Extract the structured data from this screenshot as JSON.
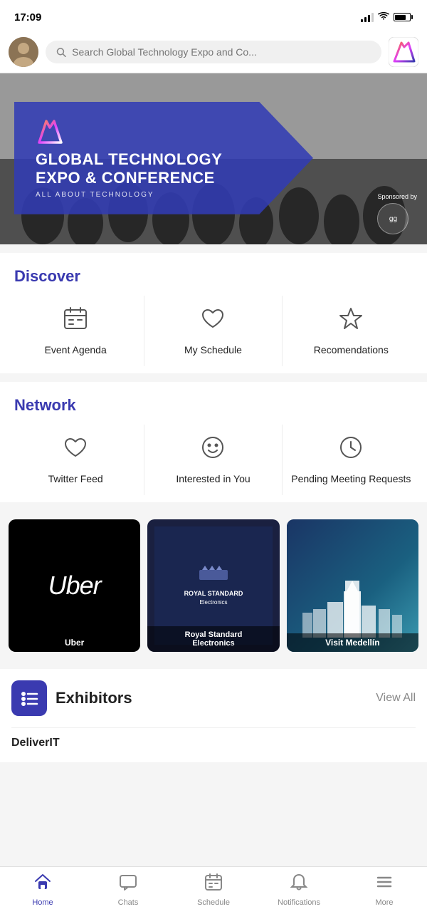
{
  "statusBar": {
    "time": "17:09"
  },
  "header": {
    "searchPlaceholder": "Search Global Technology Expo and Co...",
    "logoAlt": "App Logo"
  },
  "banner": {
    "title": "GLOBAL TECHNOLOGY\nEXPO & CONFERENCE",
    "subtitle": "ALL ABOUT TECHNOLOGY",
    "sponsoredBy": "Sponsored by",
    "sponsorInitials": "gg"
  },
  "discover": {
    "sectionTitle": "Discover",
    "items": [
      {
        "label": "Event Agenda",
        "icon": "calendar"
      },
      {
        "label": "My Schedule",
        "icon": "heart"
      },
      {
        "label": "Recomendations",
        "icon": "star"
      }
    ]
  },
  "network": {
    "sectionTitle": "Network",
    "items": [
      {
        "label": "Twitter Feed",
        "icon": "heart"
      },
      {
        "label": "Interested in You",
        "icon": "smiley"
      },
      {
        "label": "Pending Meeting Requests",
        "icon": "clock"
      }
    ]
  },
  "partners": [
    {
      "name": "Uber",
      "label": "Uber",
      "type": "uber"
    },
    {
      "name": "Royal Standard Electronics",
      "label": "Royal Standard\nElectronics",
      "type": "royal"
    },
    {
      "name": "Visit Medellín",
      "label": "Visit Medellín",
      "type": "medellin"
    }
  ],
  "exhibitors": {
    "sectionTitle": "Exhibitors",
    "viewAllLabel": "View All",
    "items": [
      {
        "name": "DeliverIT"
      }
    ]
  },
  "bottomNav": {
    "items": [
      {
        "label": "Home",
        "icon": "home",
        "active": true
      },
      {
        "label": "Chats",
        "icon": "chat",
        "active": false
      },
      {
        "label": "Schedule",
        "icon": "schedule",
        "active": false
      },
      {
        "label": "Notifications",
        "icon": "bell",
        "active": false
      },
      {
        "label": "More",
        "icon": "menu",
        "active": false
      }
    ]
  }
}
